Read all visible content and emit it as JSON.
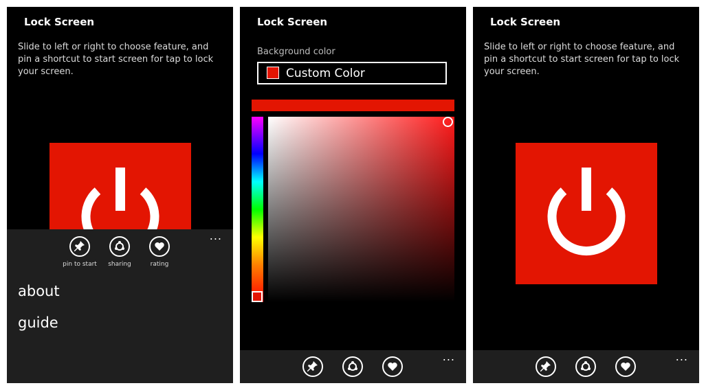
{
  "screens": [
    {
      "title": "Lock Screen",
      "description": "Slide to left or right to choose feature, and pin a shortcut to start screen for tap to lock your screen.",
      "appbar": {
        "more": "...",
        "buttons": [
          {
            "label": "pin to start",
            "icon": "pin-icon"
          },
          {
            "label": "sharing",
            "icon": "sharing-icon"
          },
          {
            "label": "rating",
            "icon": "heart-icon"
          }
        ],
        "menu": [
          "about",
          "guide"
        ]
      }
    },
    {
      "title": "Lock Screen",
      "background_label": "Background color",
      "selected_color": "Custom Color",
      "appbar": {
        "more": "...",
        "icons": [
          "pin-icon",
          "sharing-icon",
          "heart-icon"
        ]
      }
    },
    {
      "title": "Lock Screen",
      "description": "Slide to left or right to choose feature, and pin a shortcut to start screen for tap to lock your screen.",
      "appbar": {
        "more": "...",
        "icons": [
          "pin-icon",
          "sharing-icon",
          "heart-icon"
        ]
      }
    }
  ],
  "colors": {
    "accent": "#e31502",
    "background": "#000000",
    "appbar": "#1f1f1f"
  }
}
